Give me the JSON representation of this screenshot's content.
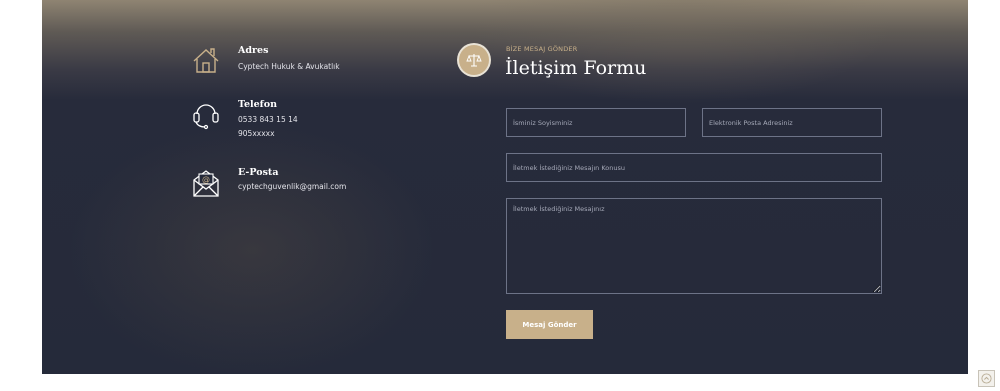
{
  "contact": {
    "address": {
      "icon": "house-icon",
      "title": "Adres",
      "lines": [
        "Cyptech Hukuk & Avukatlık"
      ]
    },
    "phone": {
      "icon": "headset-icon",
      "title": "Telefon",
      "lines": [
        "0533 843 15 14",
        "905xxxxx"
      ]
    },
    "email": {
      "icon": "envelope-icon",
      "title": "E-Posta",
      "lines": [
        "cyptechguvenlik@gmail.com"
      ]
    }
  },
  "form": {
    "badge_icon": "scales-icon",
    "eyebrow": "BİZE MESAJ GÖNDER",
    "title": "İletişim Formu",
    "name_placeholder": "İsminiz Soyisminiz",
    "email_placeholder": "Elektronik Posta Adresiniz",
    "subject_placeholder": "İletmek İstediğiniz Mesajın Konusu",
    "message_placeholder": "İletmek İstediğiniz Mesajınız",
    "submit_label": "Mesaj Gönder"
  },
  "scroll_top_icon": "chevron-up-icon",
  "colors": {
    "accent": "#c8b08a",
    "panel": "#252a3a",
    "field_border": "#6d7387"
  }
}
